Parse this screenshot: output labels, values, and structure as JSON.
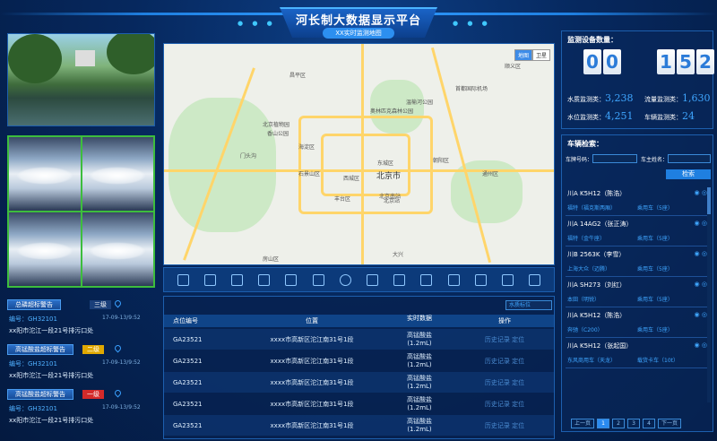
{
  "header": {
    "title": "河长制大数据显示平台",
    "subtitle": "XX实时监测地图",
    "dots_left": "● ● ●",
    "dots_right": "● ● ●"
  },
  "alerts": [
    {
      "title": "总磷超标警告",
      "level": "三级",
      "level_color": "#1a3f7a",
      "code": "编号：GH32101",
      "time": "17-09-13/9:52",
      "text": "xx阳市沱江一段21号排污口处"
    },
    {
      "title": "高锰酸盐超标警告",
      "level": "二级",
      "level_color": "#e0a800",
      "code": "编号：GH32101",
      "time": "17-09-13/9:52",
      "text": "xx阳市沱江一段21号排污口处"
    },
    {
      "title": "高锰酸盐超标警告",
      "level": "一级",
      "level_color": "#d42a2a",
      "code": "编号：GH32101",
      "time": "17-09-13/9:52",
      "text": "xx阳市沱江一段21号排污口处"
    }
  ],
  "map": {
    "center_label": "北京市",
    "toggle": [
      "地图",
      "卫星"
    ],
    "labels": [
      "顺义区",
      "昌平区",
      "海淀区",
      "朝阳区",
      "石景山区",
      "东城区",
      "西城区",
      "丰台区",
      "通州区",
      "门头沟",
      "房山区",
      "北京站",
      "北京南站",
      "首都国际机场",
      "奥林匹克森林公园",
      "北京植物园",
      "香山公园",
      "温榆河公园",
      "大兴"
    ]
  },
  "toolbar": [
    "fullscreen-icon",
    "layers-icon",
    "grid-icon",
    "prev-icon",
    "next-icon",
    "image-icon",
    "globe-icon",
    "camera-icon",
    "building-icon",
    "flask-icon",
    "chart-icon",
    "truck-icon",
    "export-icon",
    "refresh-icon"
  ],
  "table": {
    "select": "水质标位",
    "headers": [
      "点位编号",
      "位置",
      "实时数据",
      "操作"
    ],
    "rows": [
      {
        "id": "GA23521",
        "loc": "xxxx市高新区沱江南31号1段",
        "data1": "高锰酸盐",
        "data2": "(1.2mL)",
        "op": "历史记录 定位"
      },
      {
        "id": "GA23521",
        "loc": "xxxx市高新区沱江南31号1段",
        "data1": "高锰酸盐",
        "data2": "(1.2mL)",
        "op": "历史记录 定位"
      },
      {
        "id": "GA23521",
        "loc": "xxxx市高新区沱江南31号1段",
        "data1": "高锰酸盐",
        "data2": "(1.2mL)",
        "op": "历史记录 定位"
      },
      {
        "id": "GA23521",
        "loc": "xxxx市高新区沱江南31号1段",
        "data1": "高锰酸盐",
        "data2": "(1.2mL)",
        "op": "历史记录 定位"
      },
      {
        "id": "GA23521",
        "loc": "xxxx市高新区沱江南31号1段",
        "data1": "高锰酸盐",
        "data2": "(1.2mL)",
        "op": "历史记录 定位"
      }
    ]
  },
  "devices": {
    "title": "监测设备数量：",
    "digits": [
      "0",
      "0",
      "1",
      "5",
      "2"
    ],
    "stats": [
      {
        "label": "水质监测类：",
        "value": "3,238"
      },
      {
        "label": "流量监测类：",
        "value": "1,630"
      },
      {
        "label": "水位监测类：",
        "value": "4,251"
      },
      {
        "label": "车辆监测类：",
        "value": "24"
      }
    ]
  },
  "vehicles": {
    "title": "车辆检索：",
    "plate_label": "车牌号码：",
    "owner_label": "车主姓名：",
    "search": "检索",
    "items": [
      {
        "name": "川A K5H12（陈浩）",
        "sub": "福特（福克斯两厢）",
        "type": "乘用车（5座）"
      },
      {
        "name": "川A 14AG2（张正涛）",
        "sub": "福特（金牛座）",
        "type": "乘用车（5座）"
      },
      {
        "name": "川B 2563K（李雪）",
        "sub": "上海大众（迈腾）",
        "type": "乘用车（5座）"
      },
      {
        "name": "川A SH273（刘红）",
        "sub": "本田（明锐）",
        "type": "乘用车（5座）"
      },
      {
        "name": "川A K5H12（陈浩）",
        "sub": "奔驰（C200）",
        "type": "乘用车（5座）"
      },
      {
        "name": "川A K5H12（张起国）",
        "sub": "东风商用车（天龙）",
        "type": "载货卡车（10t）"
      }
    ],
    "pager": [
      "上一页",
      "1",
      "2",
      "3",
      "4",
      "下一页"
    ]
  }
}
